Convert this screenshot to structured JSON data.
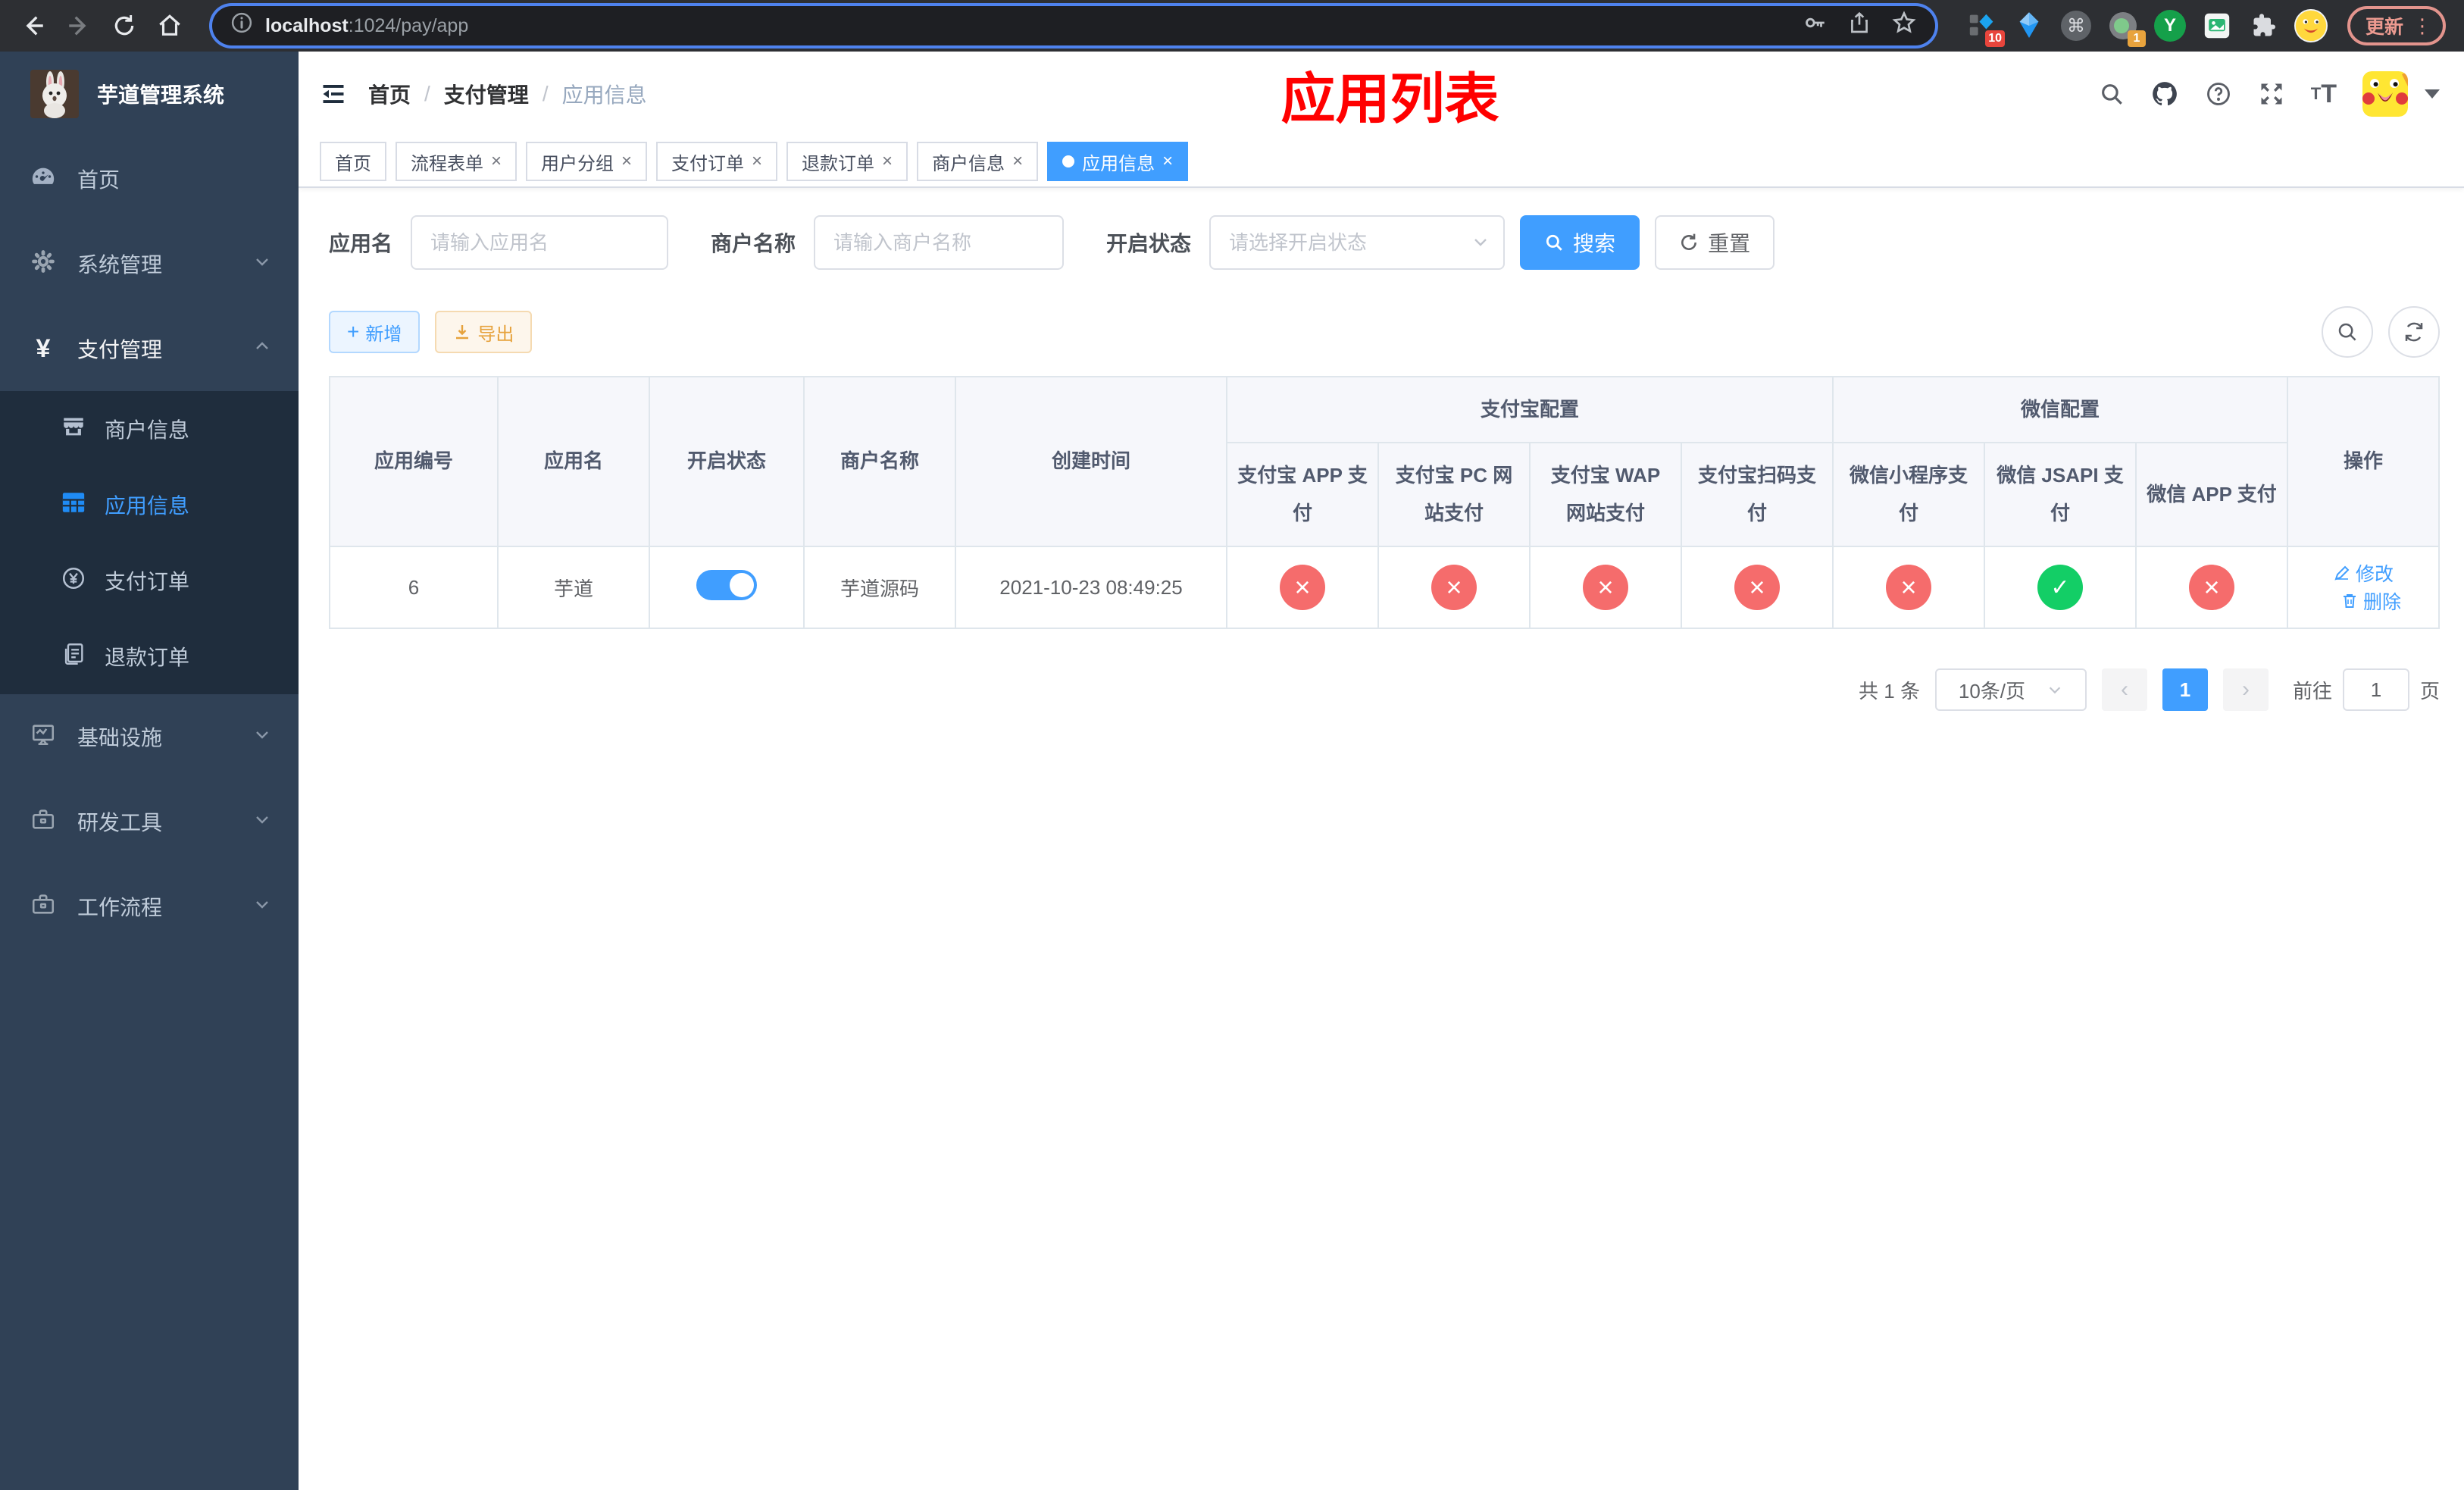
{
  "browser": {
    "url_host": "localhost",
    "url_rest": ":1024/pay/app",
    "ext_badge_count_1": "10",
    "ext_badge_count_2": "1",
    "ext_y_letter": "Y",
    "update_label": "更新"
  },
  "sidebar": {
    "title": "芋道管理系统",
    "items": [
      {
        "key": "home",
        "label": "首页"
      },
      {
        "key": "system",
        "label": "系统管理"
      },
      {
        "key": "payment",
        "label": "支付管理",
        "children": [
          {
            "key": "merchant-info",
            "label": "商户信息"
          },
          {
            "key": "app-info",
            "label": "应用信息",
            "active": true
          },
          {
            "key": "pay-order",
            "label": "支付订单"
          },
          {
            "key": "refund-order",
            "label": "退款订单"
          }
        ]
      },
      {
        "key": "infrastructure",
        "label": "基础设施"
      },
      {
        "key": "dev-tools",
        "label": "研发工具"
      },
      {
        "key": "workflow",
        "label": "工作流程"
      }
    ]
  },
  "header": {
    "breadcrumb": [
      "首页",
      "支付管理",
      "应用信息"
    ],
    "annotation": "应用列表"
  },
  "tabs": [
    {
      "label": "首页",
      "closable": false,
      "active": false
    },
    {
      "label": "流程表单",
      "closable": true,
      "active": false
    },
    {
      "label": "用户分组",
      "closable": true,
      "active": false
    },
    {
      "label": "支付订单",
      "closable": true,
      "active": false
    },
    {
      "label": "退款订单",
      "closable": true,
      "active": false
    },
    {
      "label": "商户信息",
      "closable": true,
      "active": false
    },
    {
      "label": "应用信息",
      "closable": true,
      "active": true
    }
  ],
  "filters": {
    "app_name_label": "应用名",
    "app_name_placeholder": "请输入应用名",
    "merchant_label": "商户名称",
    "merchant_placeholder": "请输入商户名称",
    "status_label": "开启状态",
    "status_placeholder": "请选择开启状态",
    "search_label": "搜索",
    "reset_label": "重置"
  },
  "toolbar": {
    "add_label": "新增",
    "export_label": "导出"
  },
  "table": {
    "group_alipay": "支付宝配置",
    "group_wechat": "微信配置",
    "col_app_id": "应用编号",
    "col_app_name": "应用名",
    "col_status": "开启状态",
    "col_merchant": "商户名称",
    "col_created": "创建时间",
    "col_alipay_app": "支付宝 APP 支付",
    "col_alipay_pc": "支付宝 PC 网站支付",
    "col_alipay_wap": "支付宝 WAP 网站支付",
    "col_alipay_qr": "支付宝扫码支付",
    "col_wx_mini": "微信小程序支付",
    "col_wx_jsapi": "微信 JSAPI 支付",
    "col_wx_app": "微信 APP 支付",
    "col_actions": "操作",
    "row": {
      "id": "6",
      "name": "芋道",
      "enabled": true,
      "merchant": "芋道源码",
      "created": "2021-10-23 08:49:25",
      "configs": [
        false,
        false,
        false,
        false,
        false,
        true,
        false
      ],
      "edit_label": "修改",
      "delete_label": "删除"
    }
  },
  "pagination": {
    "total": "共 1 条",
    "page_size": "10条/页",
    "prev": "‹",
    "page": "1",
    "next": "›",
    "goto_label": "前往",
    "goto_value": "1",
    "goto_suffix": "页"
  },
  "colors": {
    "accent": "#409eff",
    "success": "#13ce66",
    "danger": "#f56c6c",
    "warning": "#e6a23c",
    "sidebar_bg": "#304156",
    "submenu_bg": "#1f2d3d",
    "annotation_red": "#ff0000"
  }
}
